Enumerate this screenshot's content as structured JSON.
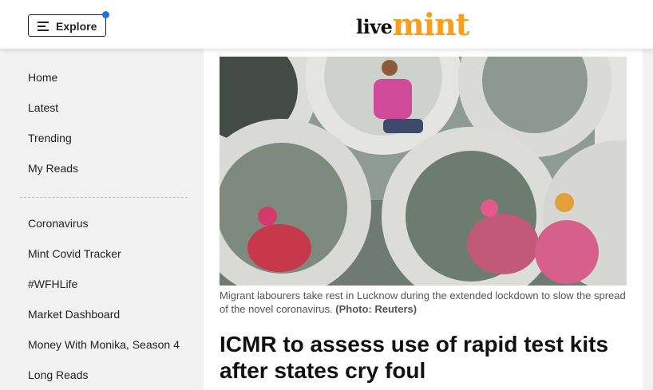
{
  "header": {
    "explore_label": "Explore",
    "logo_live": "live",
    "logo_mint": "mint",
    "accent_color": "#f99d1c",
    "notification_color": "#1a73e8"
  },
  "sidebar": {
    "primary": [
      "Home",
      "Latest",
      "Trending",
      "My Reads"
    ],
    "secondary": [
      "Coronavirus",
      "Mint Covid Tracker",
      "#WFHLife",
      "Market Dashboard",
      "Money With Monika, Season 4",
      "Long Reads"
    ]
  },
  "article": {
    "caption_text": "Migrant labourers take rest in Lucknow during the extended lockdown to slow the spread of the novel coronavirus. ",
    "caption_credit": "(Photo: Reuters)",
    "headline": "ICMR to assess use of rapid test kits after states cry foul"
  }
}
